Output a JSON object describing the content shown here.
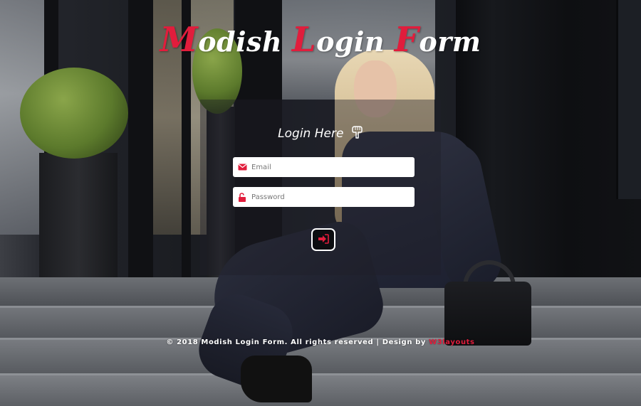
{
  "title": {
    "parts": [
      {
        "cap": "M",
        "rest": "odish "
      },
      {
        "cap": "L",
        "rest": "ogin "
      },
      {
        "cap": "F",
        "rest": "orm"
      }
    ]
  },
  "form": {
    "heading": "Login Here",
    "heading_icon": "hand-pointing-down-icon",
    "email": {
      "placeholder": "Email",
      "icon": "envelope-icon",
      "value": ""
    },
    "password": {
      "placeholder": "Password",
      "icon": "unlock-icon",
      "value": ""
    },
    "submit_icon": "sign-in-icon"
  },
  "footer": {
    "text": "© 2018 Modish Login Form. All rights reserved | Design by",
    "link_text": "W3layouts"
  },
  "colors": {
    "accent": "#e11d3c",
    "text": "#ffffff",
    "panel": "rgba(30,32,40,0.42)"
  }
}
